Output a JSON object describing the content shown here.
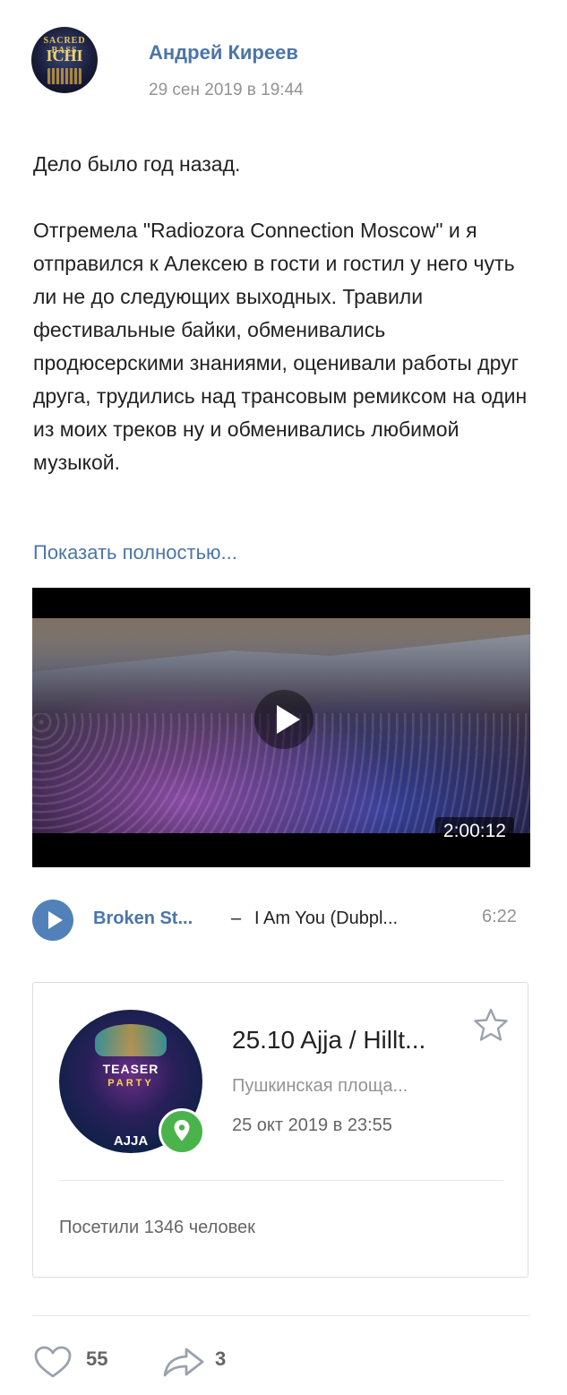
{
  "post": {
    "author": "Андрей Киреев",
    "date": "29 сен 2019 в 19:44",
    "avatar": {
      "line1": "SACRED BASS",
      "line2": "ICHI"
    },
    "text": {
      "p1": "Дело было год назад.",
      "p2": "Отгремела \"Radiozora Connection Moscow\" и я отправился к Алексею в гости и гостил у него чуть ли не до следующих выходных. Травили фестивальные байки, обменивались продюсерскими знаниями, оценивали работы друг друга, трудились над трансовым ремиксом на один из моих треков ну и обменивались любимой музыкой."
    },
    "show_more": "Показать полностью..."
  },
  "video": {
    "duration": "2:00:12",
    "play_icon": "play-icon"
  },
  "audio": {
    "artist": "Broken St...",
    "dash": "–",
    "title": "I Am You (Dubpl...",
    "duration": "6:22",
    "play_icon": "play-icon"
  },
  "event": {
    "title": "25.10 Ajja / Hillt...",
    "place": "Пушкинская площа...",
    "time": "25 окт 2019 в 23:55",
    "visitors": "Посетили 1346 человек",
    "image": {
      "line1": "TEASER",
      "line2": "PARTY",
      "line3": "AJJA"
    },
    "star_icon": "star-icon",
    "geo_icon": "map-pin-icon"
  },
  "footer": {
    "likes": "55",
    "shares": "3"
  },
  "colors": {
    "link": "#4a76a8",
    "accent": "#5181b8",
    "geo": "#4bb34b",
    "muted": "#939393"
  }
}
